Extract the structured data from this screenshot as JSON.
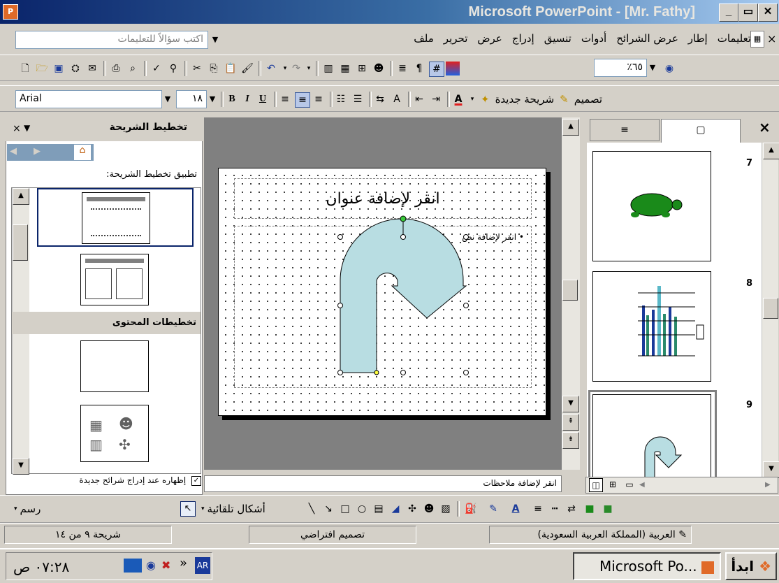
{
  "window": {
    "title": "Microsoft PowerPoint - [Mr. Fathy]",
    "app_icon": "P",
    "min_label": "_",
    "restore_label": "▭",
    "close_label": "✕"
  },
  "menu": {
    "help_placeholder": "اكتب سؤالاً للتعليمات",
    "items": [
      "ملف",
      "تحرير",
      "عرض",
      "إدراج",
      "تنسيق",
      "أدوات",
      "عرض الشرائح",
      "إطار",
      "تعليمات"
    ],
    "close": "×"
  },
  "standard_toolbar": {
    "zoom": "٪٦٥"
  },
  "formatting_toolbar": {
    "font": "Arial",
    "size": "١٨",
    "bold": "B",
    "italic": "I",
    "underline": "U",
    "new_slide": "شريحة جديدة",
    "design": "تصميم"
  },
  "layout_pane": {
    "title": "تخطيط الشريحة",
    "apply_label": "تطبيق تخطيط الشريحة:",
    "content_layouts_header": "تخطيطات المحتوى",
    "show_on_insert": "إظهاره عند إدراج شرائح جديدة",
    "show_on_insert_checked": true
  },
  "slide": {
    "title_placeholder": "انقر لإضافة عنوان",
    "body_placeholder": "انقر لإضافة نص"
  },
  "notes": {
    "placeholder": "انقر لإضافة ملاحظات"
  },
  "slides_pane": {
    "tab_outline": "≡",
    "tab_slides": "▢",
    "close": "×",
    "thumbnails": [
      {
        "number": "7"
      },
      {
        "number": "8"
      },
      {
        "number": "9"
      }
    ]
  },
  "drawing_toolbar": {
    "draw_label": "رسم",
    "autoshapes_label": "أشكال تلقائية"
  },
  "status": {
    "slide_info": "شريحة ٩ من ١٤",
    "design": "تصميم افتراضي",
    "language": "العربية (المملكة العربية السعودية)"
  },
  "taskbar": {
    "start": "ابدأ",
    "task_label": "Microsoft Po...",
    "lang": "AR",
    "clock": "٠٧:٢٨ ص",
    "chevron": "»"
  },
  "colors": {
    "title_bar_start": "#0a246a",
    "arrow_fill": "#b8dde2",
    "turtle": "#1a8a1a",
    "chart_blue": "#1a3a9a",
    "chart_green": "#2a8a6a"
  }
}
